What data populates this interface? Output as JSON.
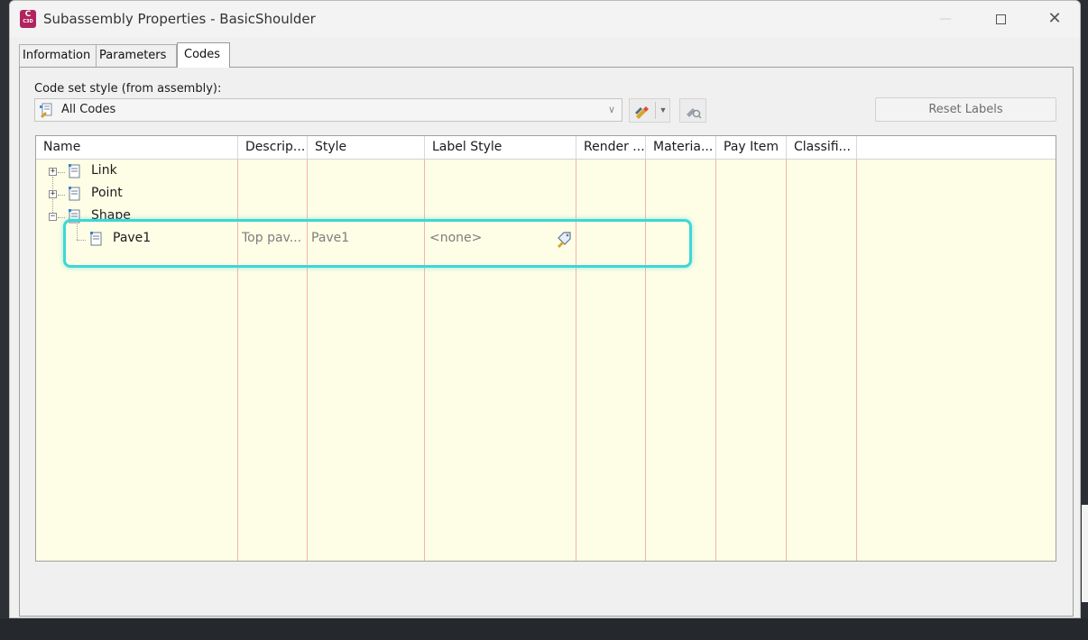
{
  "window": {
    "title": "Subassembly Properties - BasicShoulder",
    "app_icon_letter": "C",
    "app_icon_sub": "C3D"
  },
  "tabs": [
    {
      "label": "Information",
      "active": false
    },
    {
      "label": "Parameters",
      "active": false
    },
    {
      "label": "Codes",
      "active": true
    }
  ],
  "codes": {
    "code_set_label": "Code set style (from assembly):",
    "code_set_value": "All Codes",
    "reset_labels": "Reset Labels"
  },
  "grid": {
    "columns": [
      "Name",
      "Descrip...",
      "Style",
      "Label Style",
      "Render ...",
      "Materia...",
      "Pay Item",
      "Classifi..."
    ],
    "tree": [
      {
        "name": "Link",
        "expander": "+"
      },
      {
        "name": "Point",
        "expander": "+"
      },
      {
        "name": "Shape",
        "expander": "−"
      }
    ],
    "child_row": {
      "name": "Pave1",
      "description": "Top pav...",
      "style": "Pave1",
      "label_style": "<none>"
    }
  },
  "colors": {
    "grid_background": "#fefee6",
    "column_divider": "#f1b6a6",
    "highlight": "#3fd6d6",
    "app_icon": "#b0245f"
  }
}
